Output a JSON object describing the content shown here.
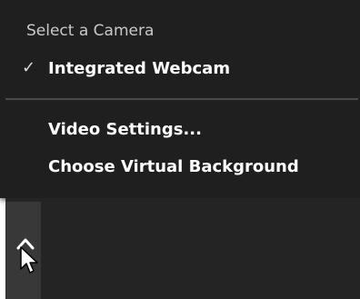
{
  "camera_menu": {
    "heading": "Select a Camera",
    "items": [
      {
        "label": "Integrated Webcam",
        "checked": true,
        "check_glyph": "✓"
      },
      {
        "label": "Video Settings..."
      },
      {
        "label": "Choose Virtual Background"
      }
    ]
  },
  "toolbar": {
    "expand_button_icon": "chevron-up-icon"
  },
  "colors": {
    "menu_background": "#1f1f20",
    "toolbar_background": "#242424",
    "text": "#ffffff",
    "heading_text": "#c9c9c9"
  }
}
